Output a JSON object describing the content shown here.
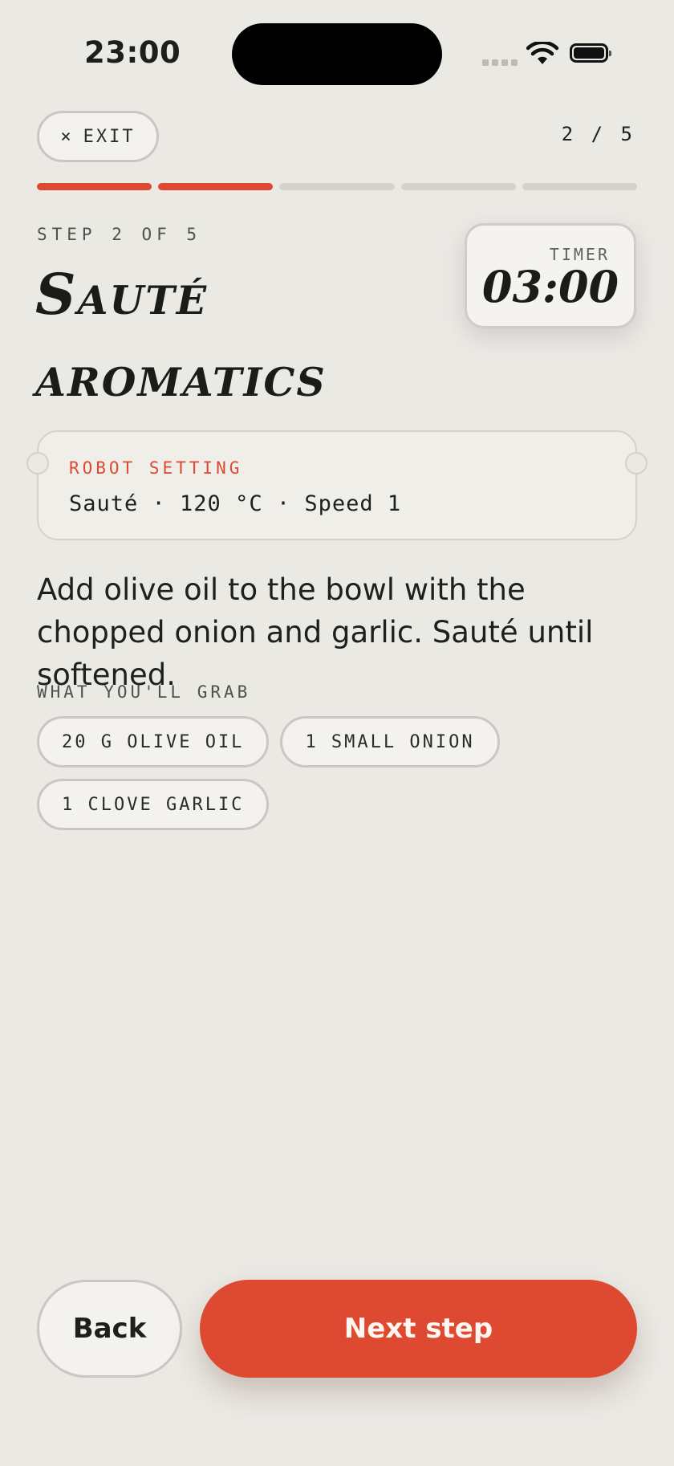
{
  "status_bar": {
    "time": "23:00",
    "icons": [
      "cellular-signal-icon",
      "wifi-icon",
      "battery-icon"
    ]
  },
  "header": {
    "exit_icon": "×",
    "exit_label": "EXIT",
    "step_counter": "2 / 5"
  },
  "progress": {
    "completed": 2,
    "total": 5
  },
  "step": {
    "label": "STEP 2 OF 5",
    "title": "Sauté aromatics"
  },
  "timer": {
    "label": "TIMER",
    "value": "03:00"
  },
  "robot_setting": {
    "label": "ROBOT SETTING",
    "value": "Sauté · 120 °C · Speed 1"
  },
  "instruction": "Add olive oil to the bowl with the chopped onion and garlic. Sauté until softened.",
  "ingredients": {
    "label": "WHAT YOU'LL GRAB",
    "items": [
      "20 G OLIVE OIL",
      "1 SMALL ONION",
      "1 CLOVE GARLIC"
    ]
  },
  "actions": {
    "back_label": "Back",
    "next_label": "Next step"
  },
  "colors": {
    "accent": "#DE4A31",
    "background": "#EBE9E4",
    "card": "#F4F2EE",
    "text": "#1D1F1A"
  }
}
